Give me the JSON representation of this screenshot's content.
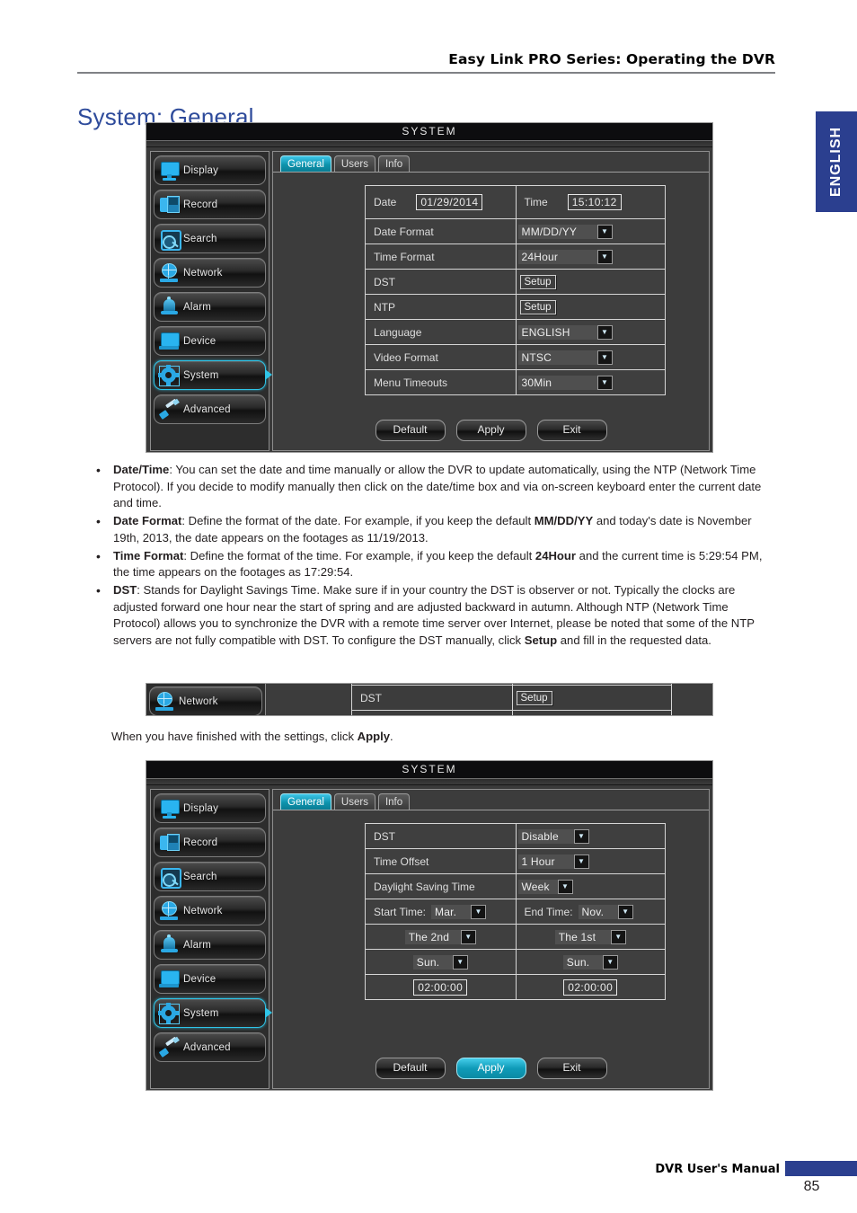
{
  "header": {
    "running_head": "Easy Link PRO Series: Operating the DVR",
    "page_title": "System: General",
    "language_tab": "ENGLISH"
  },
  "footer": {
    "manual_label": "DVR User's Manual",
    "page_number": "85"
  },
  "colors": {
    "brand_blue": "#2b3f8f",
    "title_blue": "#2e4b9b",
    "accent_teal": "#0d93ad",
    "icon_blue": "#29b4f0"
  },
  "figure1": {
    "window_title": "SYSTEM",
    "nav": [
      {
        "label": "Display",
        "icon": "display-icon",
        "selected": false
      },
      {
        "label": "Record",
        "icon": "record-icon",
        "selected": false
      },
      {
        "label": "Search",
        "icon": "search-icon",
        "selected": false
      },
      {
        "label": "Network",
        "icon": "network-icon",
        "selected": false
      },
      {
        "label": "Alarm",
        "icon": "alarm-icon",
        "selected": false
      },
      {
        "label": "Device",
        "icon": "device-icon",
        "selected": false
      },
      {
        "label": "System",
        "icon": "system-gear-icon",
        "selected": true
      },
      {
        "label": "Advanced",
        "icon": "advanced-screwdriver-icon",
        "selected": false
      }
    ],
    "tabs": [
      {
        "label": "General",
        "active": true
      },
      {
        "label": "Users",
        "active": false
      },
      {
        "label": "Info",
        "active": false
      }
    ],
    "fields": {
      "date_label": "Date",
      "date_value": "01/29/2014",
      "time_label": "Time",
      "time_value": "15:10:12",
      "date_format_label": "Date Format",
      "date_format_value": "MM/DD/YY",
      "time_format_label": "Time Format",
      "time_format_value": "24Hour",
      "dst_label": "DST",
      "dst_button": "Setup",
      "ntp_label": "NTP",
      "ntp_button": "Setup",
      "language_label": "Language",
      "language_value": "ENGLISH",
      "video_format_label": "Video Format",
      "video_format_value": "NTSC",
      "menu_timeouts_label": "Menu Timeouts",
      "menu_timeouts_value": "30Min"
    },
    "actions": {
      "default": "Default",
      "apply": "Apply",
      "exit": "Exit",
      "apply_highlighted": false
    }
  },
  "strip": {
    "nav_label": "Network",
    "dst_label": "DST",
    "setup_button": "Setup"
  },
  "figure2": {
    "window_title": "SYSTEM",
    "nav": [
      {
        "label": "Display",
        "icon": "display-icon",
        "selected": false
      },
      {
        "label": "Record",
        "icon": "record-icon",
        "selected": false
      },
      {
        "label": "Search",
        "icon": "search-icon",
        "selected": false
      },
      {
        "label": "Network",
        "icon": "network-icon",
        "selected": false
      },
      {
        "label": "Alarm",
        "icon": "alarm-icon",
        "selected": false
      },
      {
        "label": "Device",
        "icon": "device-icon",
        "selected": false
      },
      {
        "label": "System",
        "icon": "system-gear-icon",
        "selected": true
      },
      {
        "label": "Advanced",
        "icon": "advanced-screwdriver-icon",
        "selected": false
      }
    ],
    "tabs": [
      {
        "label": "General",
        "active": true
      },
      {
        "label": "Users",
        "active": false
      },
      {
        "label": "Info",
        "active": false
      }
    ],
    "fields": {
      "dst_label": "DST",
      "dst_value": "Disable",
      "time_offset_label": "Time Offset",
      "time_offset_value": "1 Hour",
      "daylight_saving_label": "Daylight Saving Time",
      "daylight_saving_value": "Week",
      "start_time_label": "Start Time:",
      "start_month": "Mar.",
      "end_time_label": "End Time:",
      "end_month": "Nov.",
      "start_ordinal": "The 2nd",
      "end_ordinal": "The 1st",
      "start_day": "Sun.",
      "end_day": "Sun.",
      "start_clock": "02:00:00",
      "end_clock": "02:00:00"
    },
    "actions": {
      "default": "Default",
      "apply": "Apply",
      "exit": "Exit",
      "apply_highlighted": true
    }
  },
  "body": {
    "bullets": [
      {
        "term": "Date/Time",
        "text": ": You can set the date and time manually or allow the DVR to update automatically, using the NTP (Network Time Protocol). If you decide to modify manually then click on the date/time box and via on-screen keyboard enter the current date and time."
      },
      {
        "term": "Date Format",
        "text": ": Define the format of the date. For example, if you keep the default MM/DD/YY and today's date is November 19th, 2013, the date appears on the footages as 11/19/2013."
      },
      {
        "term": "Time Format",
        "text": ": Define the format of the time. For example, if you keep the default 24Hour and the current time is 5:29:54 PM, the time appears on the footages as 17:29:54."
      },
      {
        "term": "DST",
        "text": ": Stands for Daylight Savings Time. Make sure if in your country the DST is observer or not. Typically the clocks are adjusted forward one hour near the start of spring and are adjusted backward in autumn. Although NTP (Network Time Protocol) allows you to synchronize the DVR with a remote time server over Internet, please be noted that some of the NTP servers are not fully compatible with DST. To configure the DST manually, click Setup and fill in the requested data."
      }
    ],
    "closing_note": "When you have finished with the settings, click Apply."
  }
}
